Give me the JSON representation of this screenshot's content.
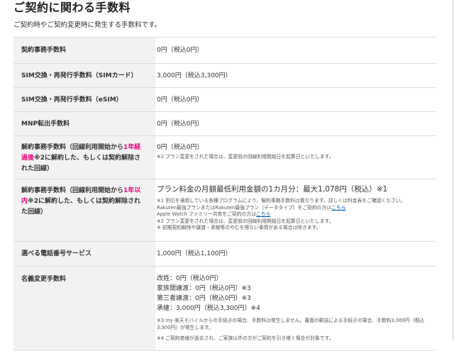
{
  "page": {
    "title": "ご契約に関わる手数料",
    "subtitle": "ご契約時やご契約変更時に発生する手数料です。"
  },
  "colors": {
    "accent": "#e6007e",
    "link": "#0057b8",
    "header_bg": "#f2f2f2",
    "border": "#dcdcdc"
  },
  "rows": {
    "r1": {
      "label": "契約事務手数料",
      "value": "0円（税込0円）"
    },
    "r2": {
      "label": "SIM交換・再発行手数料（SIMカード）",
      "value": "3,000円（税込3,300円）"
    },
    "r3": {
      "label": "SIM交換・再発行手数料（eSIM）",
      "value": "0円（税込0円）"
    },
    "r4": {
      "label": "MNP転出手数料",
      "value": "0円（税込0円）"
    },
    "r5": {
      "label_a": "解約事務手数料（回線利用開始から",
      "label_pink": "1年経過後",
      "label_b": "※2に解約した、もしくは契約解除された回線）",
      "value": "0円（税込0円）",
      "note": "※2 プラン変更をされた場合は、変更前の回線利用開始日を起算日といたします。"
    },
    "r6": {
      "label_a": "解約事務手数料（回線利用開始から",
      "label_pink": "1年以内",
      "label_b": "※2に解約した、もしくは契約解除された回線）",
      "value": "プラン料金の月額最低利用金額の1カ月分：最大1,078円（税込）※1",
      "note1": "※1 割引を適用している各種プログラムにより、解約事務手数料は異なります。詳しくは料金表をご確認ください。",
      "note2_a": "Rakuten最強プランまたはRakuten最強プラン（データタイプ）をご契約の方は",
      "note2_link": "こちら",
      "note3_a": "Apple Watch ファミリー共有をご契約の方は",
      "note3_link": "こちら",
      "note4": "※2 プラン変更をされた場合は、変更前の回線利用開始日を起算日といたします。",
      "note5": "※ 初期契約解除や譲渡・承継等のやむを得ない事情がある場合は除きます。"
    },
    "r7": {
      "label": "選べる電話番号サービス",
      "value": "1,000円（税込1,100円）"
    },
    "r8": {
      "label": "名義変更手数料",
      "line1": "改姓：0円（税込0円）",
      "line2": "家族間譲渡：0円（税込0円）※3",
      "line3": "第三者譲渡：0円（税込0円）※3",
      "line4": "承継：3,000円（税込3,300円）※4",
      "note1": "※3 my 楽天モバイルからの手続きの場合、手数料は発生しません。書面の郵送による手続きの場合、手数料3,000円（税込3,300円）が発生します。",
      "note2": "※4 ご契約者様が逝去され、ご家族以外の方がご契約を引き継ぐ場合が対象です。"
    }
  }
}
